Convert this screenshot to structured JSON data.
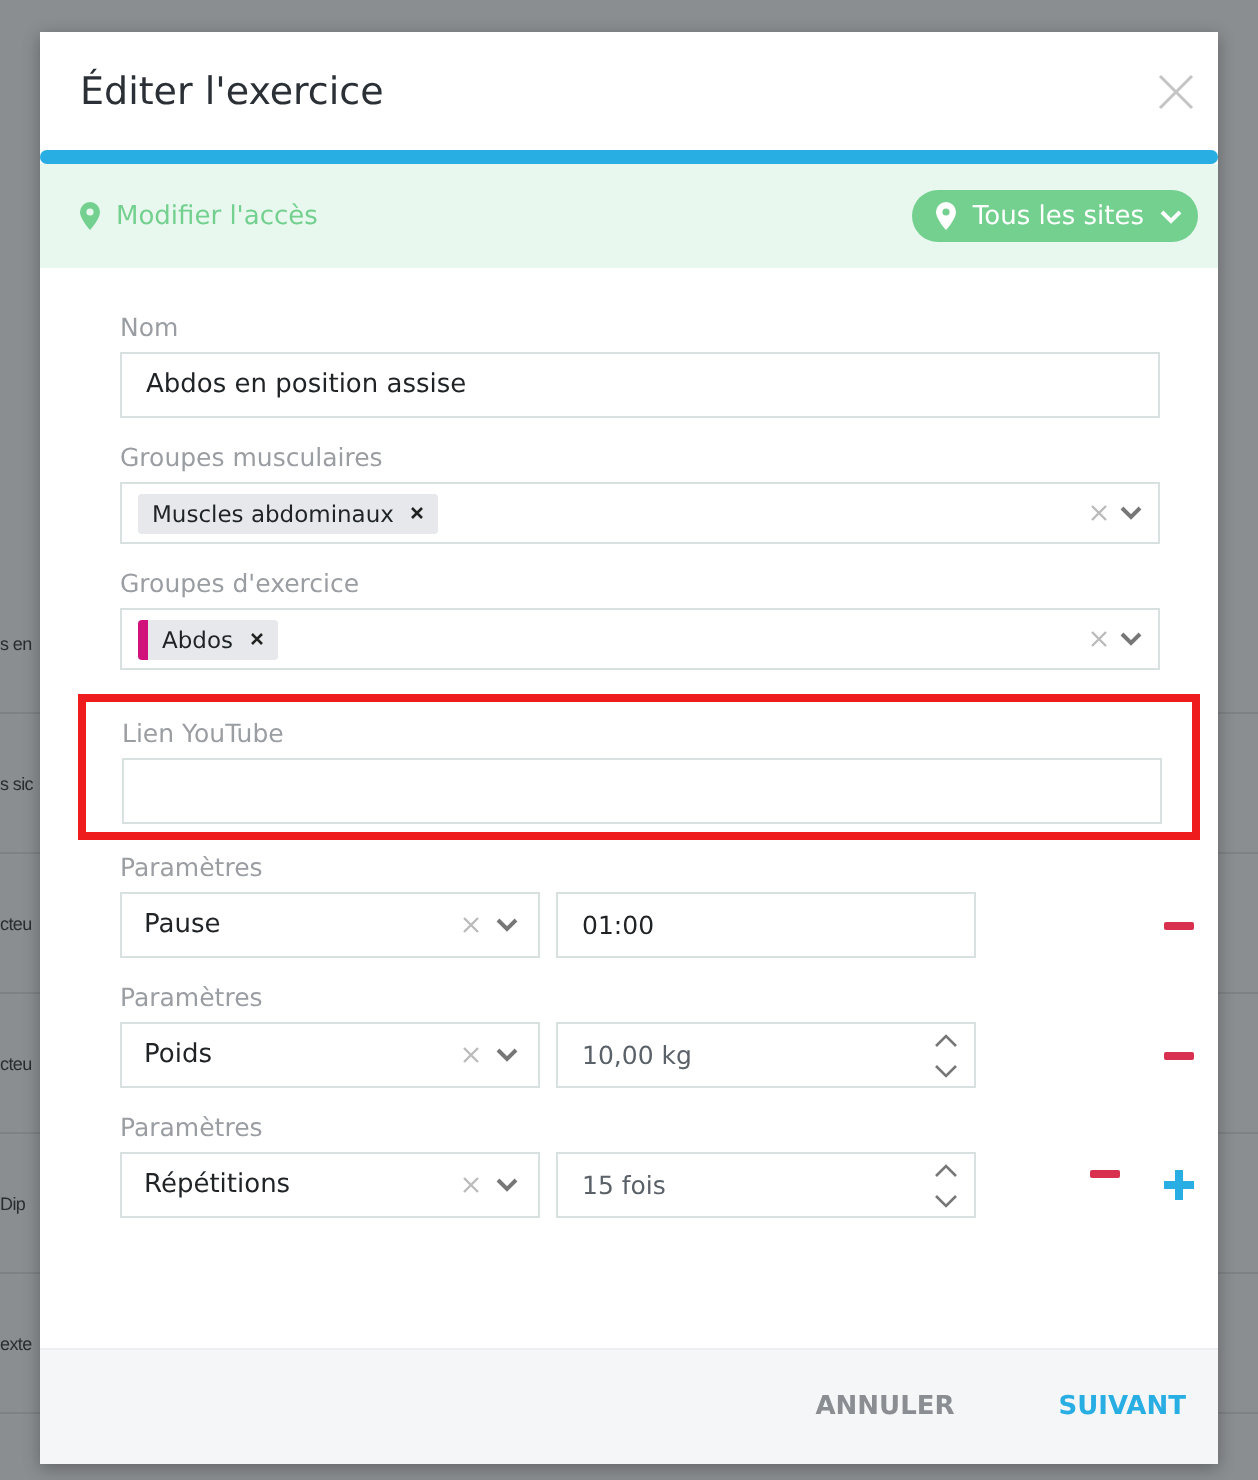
{
  "backdrop_rows": [
    "s en",
    "s sic",
    "cteu",
    "cteu",
    "Dip",
    "exte"
  ],
  "dialog": {
    "title": "Éditer l'exercice",
    "progress": {
      "level": 1
    },
    "access": {
      "label": "Modifier l'accès",
      "site_button": "Tous les sites"
    },
    "name_field": {
      "label": "Nom",
      "value": "Abdos en position assise"
    },
    "muscle_groups": {
      "label": "Groupes musculaires",
      "tags": [
        {
          "text": "Muscles abdominaux"
        }
      ]
    },
    "exercise_groups": {
      "label": "Groupes d'exercice",
      "tags": [
        {
          "text": "Abdos",
          "color": "#d0127a"
        }
      ]
    },
    "youtube_field": {
      "label": "Lien YouTube",
      "highlighted": true
    },
    "parameters": [
      {
        "label": "Paramètres",
        "type": "Pause",
        "value": "01:00",
        "spinner": false,
        "add": false
      },
      {
        "label": "Paramètres",
        "type": "Poids",
        "value": "10,00 kg",
        "spinner": true,
        "add": false
      },
      {
        "label": "Paramètres",
        "type": "Répétitions",
        "value": "15 fois",
        "spinner": true,
        "add": true
      }
    ],
    "buttons": {
      "cancel": "ANNULER",
      "next": "SUIVANT"
    }
  }
}
